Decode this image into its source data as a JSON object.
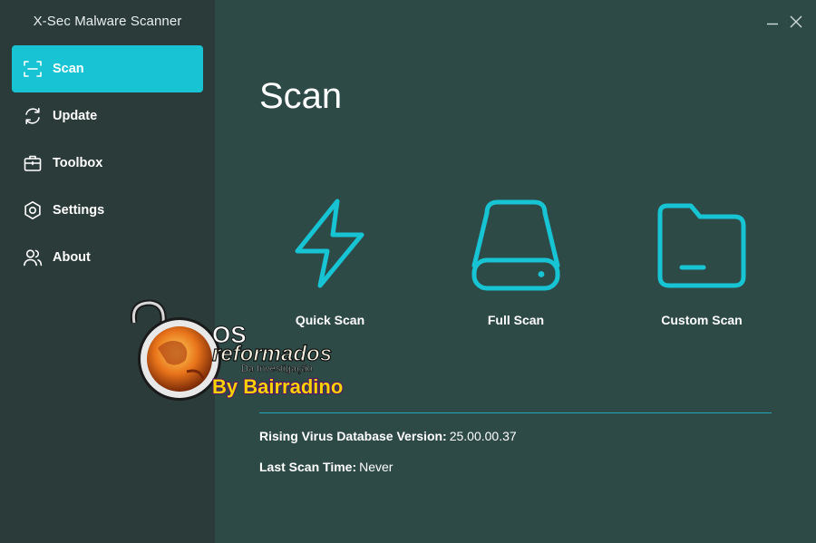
{
  "app": {
    "title": "X-Sec Malware Scanner"
  },
  "sidebar": {
    "items": [
      {
        "label": "Scan",
        "icon": "scan-frame-icon",
        "active": true
      },
      {
        "label": "Update",
        "icon": "refresh-icon",
        "active": false
      },
      {
        "label": "Toolbox",
        "icon": "toolbox-icon",
        "active": false
      },
      {
        "label": "Settings",
        "icon": "gear-icon",
        "active": false
      },
      {
        "label": "About",
        "icon": "users-icon",
        "active": false
      }
    ]
  },
  "window": {
    "minimize_icon": "minimize-icon",
    "close_icon": "close-icon"
  },
  "main": {
    "title": "Scan",
    "options": [
      {
        "label": "Quick Scan",
        "icon": "lightning-icon"
      },
      {
        "label": "Full Scan",
        "icon": "hard-drive-icon"
      },
      {
        "label": "Custom Scan",
        "icon": "folder-icon"
      }
    ],
    "info": {
      "db_label": "Rising Virus Database Version:",
      "db_value": "25.00.00.37",
      "last_scan_label": "Last Scan Time:",
      "last_scan_value": "Never"
    }
  },
  "watermark": {
    "line1": "OS",
    "line2": "reformados",
    "line3": "Da Investigação",
    "line4": "By Bairradino"
  },
  "colors": {
    "accent": "#18c3d3",
    "sidebar_bg": "#2a3b39",
    "main_bg": "#2e4a47"
  }
}
